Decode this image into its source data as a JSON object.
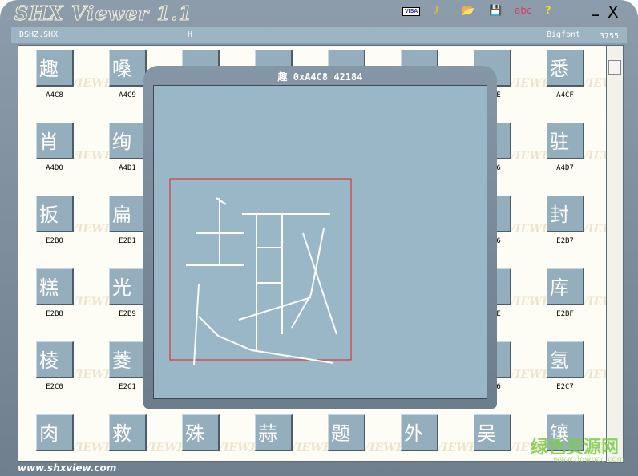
{
  "app": {
    "title": "SHX Viewer 1.1"
  },
  "toolbar": {
    "visa": "VISA",
    "abc": "abc",
    "help": "?",
    "minimize": "_",
    "close": "X"
  },
  "info": {
    "file": "DSHZ.SHX",
    "mode": "H",
    "font_type": "Bigfont",
    "count": "3755"
  },
  "grid": {
    "watermark": "SHX VIEWER",
    "rows": [
      [
        {
          "c": "趣",
          "l": "A4C8"
        },
        {
          "c": "嗓",
          "l": "A4C9"
        },
        {
          "c": "",
          "l": ""
        },
        {
          "c": "",
          "l": ""
        },
        {
          "c": "",
          "l": ""
        },
        {
          "c": "",
          "l": ""
        },
        {
          "c": "",
          "l": "A4CE"
        },
        {
          "c": "悉",
          "l": "A4CF"
        }
      ],
      [
        {
          "c": "肖",
          "l": "A4D0"
        },
        {
          "c": "绚",
          "l": "A4D1"
        },
        {
          "c": "",
          "l": ""
        },
        {
          "c": "",
          "l": ""
        },
        {
          "c": "",
          "l": ""
        },
        {
          "c": "",
          "l": ""
        },
        {
          "c": "",
          "l": "A4D6"
        },
        {
          "c": "驻",
          "l": "A4D7"
        }
      ],
      [
        {
          "c": "扳",
          "l": "E2B0"
        },
        {
          "c": "扁",
          "l": "E2B1"
        },
        {
          "c": "",
          "l": ""
        },
        {
          "c": "",
          "l": ""
        },
        {
          "c": "",
          "l": ""
        },
        {
          "c": "",
          "l": ""
        },
        {
          "c": "",
          "l": "E2B6"
        },
        {
          "c": "封",
          "l": "E2B7"
        }
      ],
      [
        {
          "c": "糕",
          "l": "E2B8"
        },
        {
          "c": "光",
          "l": "E2B9"
        },
        {
          "c": "",
          "l": ""
        },
        {
          "c": "",
          "l": ""
        },
        {
          "c": "",
          "l": ""
        },
        {
          "c": "",
          "l": ""
        },
        {
          "c": "",
          "l": "E2BE"
        },
        {
          "c": "库",
          "l": "E2BF"
        }
      ],
      [
        {
          "c": "棱",
          "l": "E2C0"
        },
        {
          "c": "菱",
          "l": "E2C1"
        },
        {
          "c": "",
          "l": ""
        },
        {
          "c": "",
          "l": ""
        },
        {
          "c": "",
          "l": ""
        },
        {
          "c": "",
          "l": ""
        },
        {
          "c": "",
          "l": "E2C6"
        },
        {
          "c": "氢",
          "l": "E2C7"
        }
      ],
      [
        {
          "c": "肉",
          "l": ""
        },
        {
          "c": "救",
          "l": ""
        },
        {
          "c": "殊",
          "l": ""
        },
        {
          "c": "蒜",
          "l": ""
        },
        {
          "c": "题",
          "l": ""
        },
        {
          "c": "外",
          "l": ""
        },
        {
          "c": "吴",
          "l": ""
        },
        {
          "c": "镶",
          "l": ""
        }
      ]
    ]
  },
  "preview": {
    "title": "趣 0xA4C8 42184",
    "box_color": "#e02020"
  },
  "footer": {
    "url": "www.shxview.com"
  },
  "watermark": {
    "text": "绿色资源网",
    "sub": "www.downcc.com"
  }
}
